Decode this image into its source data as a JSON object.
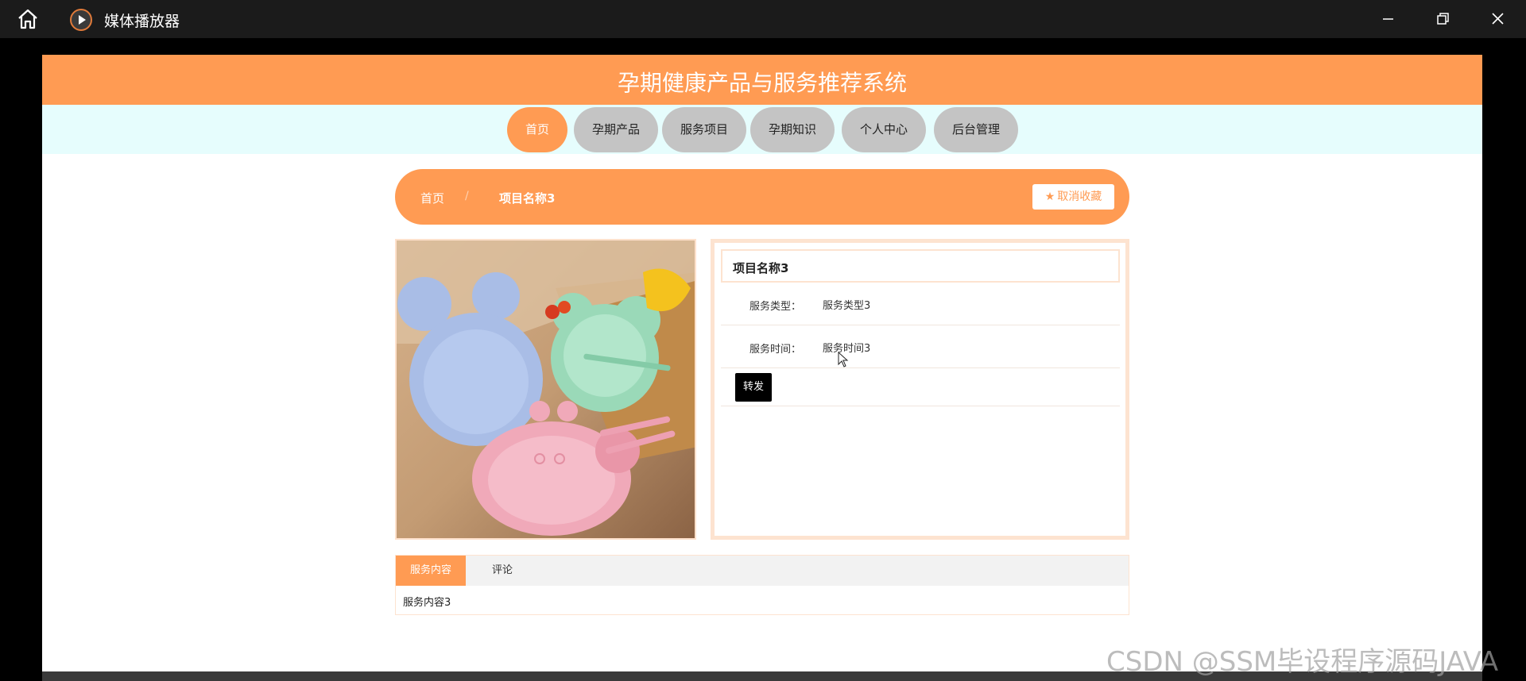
{
  "window": {
    "title": "媒体播放器",
    "icons": {
      "home": "home-icon",
      "app": "play-icon",
      "minimize": "minimize-icon",
      "maximize": "restore-icon",
      "close": "close-icon"
    }
  },
  "site": {
    "title": "孕期健康产品与服务推荐系统"
  },
  "nav": {
    "items": [
      {
        "label": "首页",
        "active": true
      },
      {
        "label": "孕期产品",
        "active": false
      },
      {
        "label": "服务项目",
        "active": false
      },
      {
        "label": "孕期知识",
        "active": false
      },
      {
        "label": "个人中心",
        "active": false
      },
      {
        "label": "后台管理",
        "active": false
      }
    ]
  },
  "breadcrumb": {
    "home": "首页",
    "separator": "/",
    "current": "项目名称3"
  },
  "favorite": {
    "label": "取消收藏",
    "icon": "star-icon"
  },
  "detail": {
    "title": "项目名称3",
    "fields": [
      {
        "label": "服务类型：",
        "value": "服务类型3"
      },
      {
        "label": "服务时间：",
        "value": "服务时间3"
      }
    ],
    "share_label": "转发"
  },
  "tabs": {
    "items": [
      {
        "label": "服务内容",
        "active": true
      },
      {
        "label": "评论",
        "active": false
      }
    ],
    "content": "服务内容3"
  },
  "watermark": "CSDN @SSM毕设程序源码JAVA",
  "colors": {
    "accent": "#ff9b53",
    "nav_bg": "#e6fdfd",
    "nav_inactive": "#c4c4c4",
    "border": "#fde3d0"
  }
}
